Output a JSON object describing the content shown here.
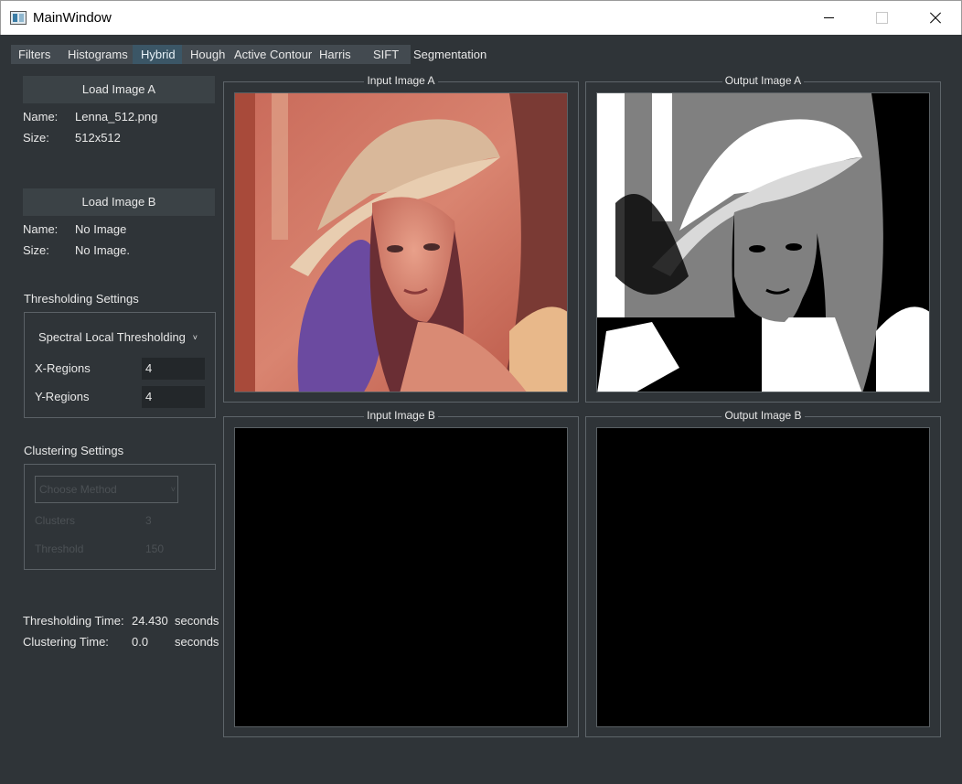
{
  "window": {
    "title": "MainWindow"
  },
  "tabs": [
    "Filters",
    "Histograms",
    "Hybrid",
    "Hough",
    "Active Contour",
    "Harris",
    "SIFT",
    "Segmentation"
  ],
  "image_a": {
    "load_label": "Load Image A",
    "name_label": "Name:",
    "name_value": "Lenna_512.png",
    "size_label": "Size:",
    "size_value": "512x512"
  },
  "image_b": {
    "load_label": "Load Image B",
    "name_label": "Name:",
    "name_value": "No Image",
    "size_label": "Size:",
    "size_value": "No Image."
  },
  "thresholding": {
    "heading": "Thresholding Settings",
    "method": "Spectral Local Thresholding",
    "x_label": "X-Regions",
    "x_value": "4",
    "y_label": "Y-Regions",
    "y_value": "4"
  },
  "clustering": {
    "heading": "Clustering Settings",
    "placeholder": "Choose Method",
    "clusters_label": "Clusters",
    "clusters_value": "3",
    "threshold_label": "Threshold",
    "threshold_value": "150"
  },
  "timing": {
    "thresholding_label": "Thresholding Time:",
    "thresholding_value": "24.430",
    "thresholding_unit": "seconds",
    "clustering_label": "Clustering Time:",
    "clustering_value": "0.0",
    "clustering_unit": "seconds"
  },
  "panels": {
    "input_a": "Input Image A",
    "output_a": "Output Image A",
    "input_b": "Input Image B",
    "output_b": "Output Image B"
  }
}
